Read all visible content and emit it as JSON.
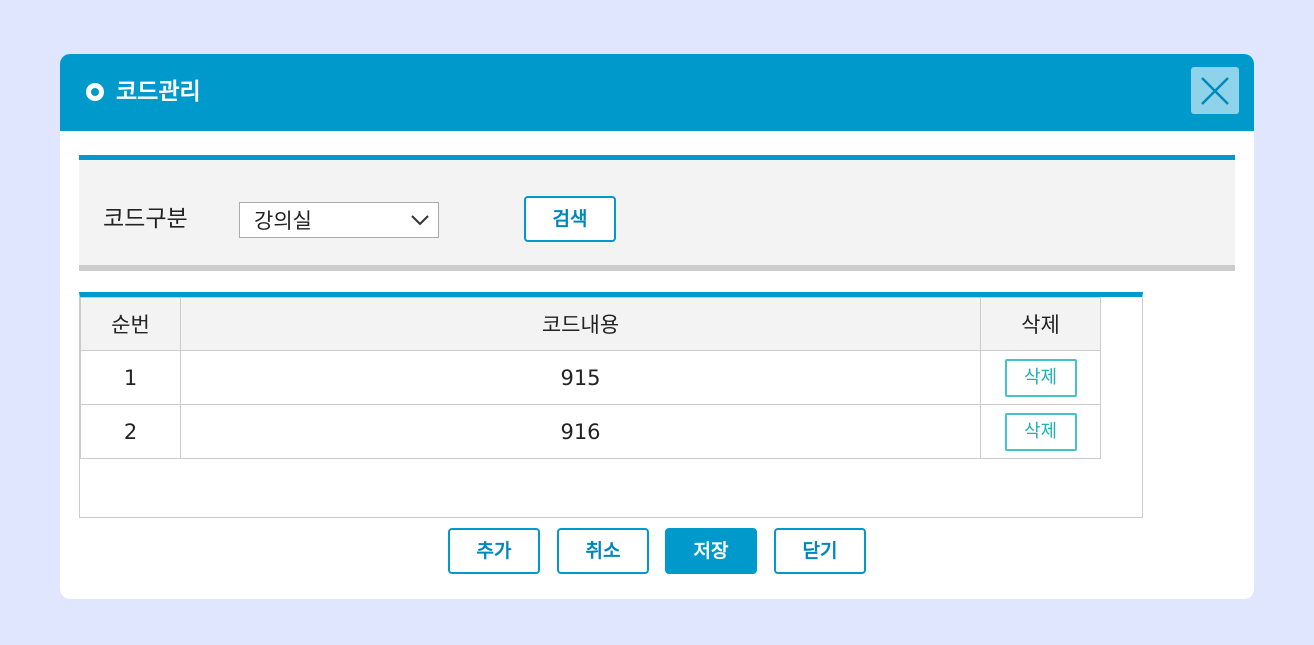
{
  "dialog": {
    "title": "코드관리",
    "close_icon": "close-icon"
  },
  "search": {
    "label": "코드구분",
    "select_value": "강의실",
    "button_label": "검색"
  },
  "table": {
    "headers": [
      "순번",
      "코드내용",
      "삭제"
    ],
    "rows": [
      {
        "num": "1",
        "content": "915",
        "delete_label": "삭제"
      },
      {
        "num": "2",
        "content": "916",
        "delete_label": "삭제"
      }
    ]
  },
  "footer": {
    "add_label": "추가",
    "cancel_label": "취소",
    "save_label": "저장",
    "close_label": "닫기"
  },
  "colors": {
    "accent": "#0099cc",
    "background": "#dfe6fd",
    "delete_button": "#20b0b8"
  }
}
